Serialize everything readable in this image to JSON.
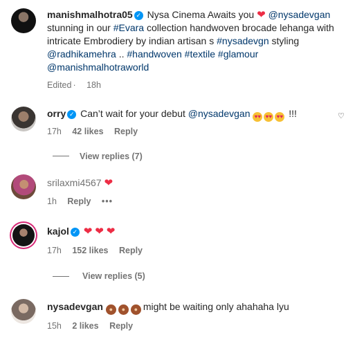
{
  "post": {
    "username": "manishmalhotra05",
    "line1_text": "Nysa Cinema Awaits you",
    "mention_nysa": "@nysadevgan",
    "line2_pre": "stunning in our",
    "tag_evara": "#Evara",
    "line2_post": "collection handwoven brocade lehanga with",
    "line3_pre": "intricate Embrodiery by indian artisan s",
    "tag_nysadevgn": "#nysadevgn",
    "line3_post": "styling",
    "mention_radhika": "@radhikamehra",
    "line4_dots": "..",
    "tag_handwoven": "#handwoven",
    "tag_textile": "#textile",
    "tag_glamour": "#glamour",
    "mention_world": "@manishmalhotraworld",
    "edited": "Edited",
    "time": "18h"
  },
  "comments": [
    {
      "username": "orry",
      "text": "Can’t wait for your debut",
      "mention": "@nysadevgan",
      "suffix": "!!!",
      "time": "17h",
      "likes": "42 likes",
      "reply": "Reply",
      "view_replies": "View replies (7)"
    },
    {
      "username": "srilaxmi4567",
      "time": "1h",
      "reply": "Reply",
      "more": "•••"
    },
    {
      "username": "kajol",
      "time": "17h",
      "likes": "152 likes",
      "reply": "Reply",
      "view_replies": "View replies (5)"
    },
    {
      "username": "nysadevgan",
      "text": "might be waiting only ahahaha lyu",
      "time": "15h",
      "likes": "2 likes",
      "reply": "Reply"
    }
  ],
  "icons": {
    "verified": "verified-badge-icon",
    "heart": "red-heart-emoji",
    "like": "heart-outline-icon"
  },
  "colors": {
    "link": "#00376b",
    "verified": "#0095f6",
    "heart": "#ed2d45",
    "meta": "#737373"
  }
}
